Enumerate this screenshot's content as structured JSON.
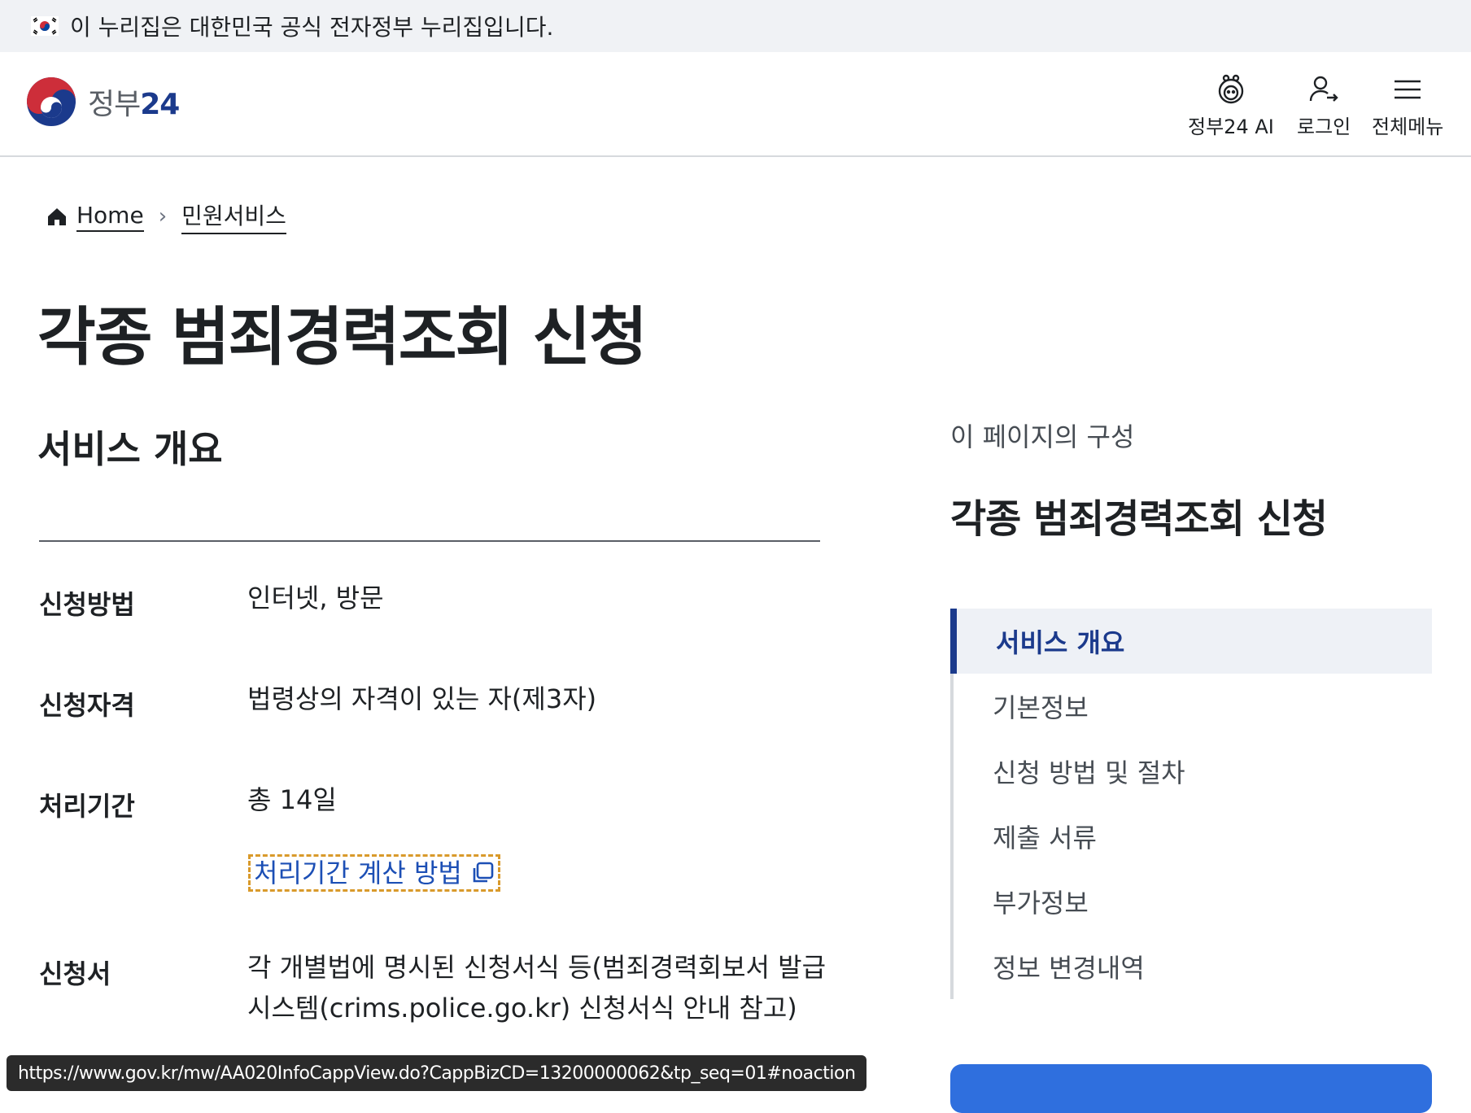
{
  "banner": {
    "text": "이 누리집은 대한민국 공식 전자정부 누리집입니다."
  },
  "header": {
    "logo_text": "정부",
    "logo_num": "24",
    "buttons": {
      "ai": "정부24 AI",
      "login": "로그인",
      "menu": "전체메뉴"
    }
  },
  "breadcrumb": {
    "home": "Home",
    "current": "민원서비스",
    "separator": "›"
  },
  "page": {
    "title": "각종 범죄경력조회 신청"
  },
  "overview": {
    "section_title": "서비스 개요",
    "rows": [
      {
        "label": "신청방법",
        "value": "인터넷, 방문"
      },
      {
        "label": "신청자격",
        "value": "법령상의 자격이 있는 자(제3자)"
      },
      {
        "label": "처리기간",
        "value": "총 14일"
      },
      {
        "label": "신청서",
        "value": "각 개별법에 명시된 신청서식 등(범죄경력회보서 발급시스템(crims.police.go.kr) 신청서식 안내 참고)"
      }
    ],
    "calc_link": "처리기간 계산 방법"
  },
  "toc": {
    "caption": "이 페이지의 구성",
    "title": "각종 범죄경력조회 신청",
    "items": [
      {
        "label": "서비스 개요",
        "active": true
      },
      {
        "label": "기본정보",
        "active": false
      },
      {
        "label": "신청 방법 및 절차",
        "active": false
      },
      {
        "label": "제출 서류",
        "active": false
      },
      {
        "label": "부가정보",
        "active": false
      },
      {
        "label": "정보 변경내역",
        "active": false
      }
    ]
  },
  "status_bar": {
    "url": "https://www.gov.kr/mw/AA020InfoCappView.do?CappBizCD=13200000062&tp_seq=01#noaction"
  },
  "colors": {
    "brand_navy": "#1b3a8c",
    "link_blue": "#1c4fb5",
    "focus_orange": "#d99a2b",
    "button_blue": "#2f6fde"
  }
}
